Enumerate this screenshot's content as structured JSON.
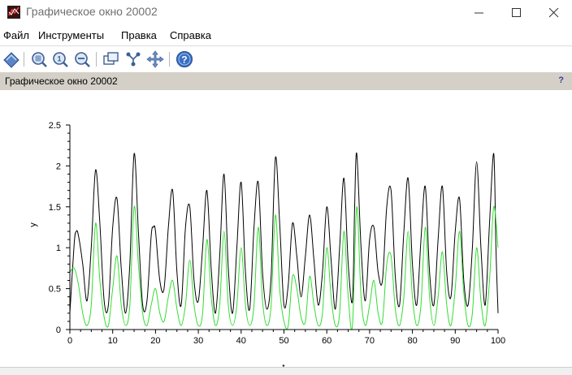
{
  "window": {
    "title": "Графическое окно 20002",
    "icon": "scilab-graphics-icon",
    "controls": [
      "minimize-icon",
      "maximize-icon",
      "close-icon"
    ]
  },
  "menubar": {
    "items": [
      "Файл",
      "Инструменты",
      "Правка",
      "Справка"
    ]
  },
  "toolbar": {
    "buttons": [
      "datatip-icon",
      "zoom-in-icon",
      "zoom-original-icon",
      "zoom-out-icon",
      "rotate-icon",
      "edit-axes-icon",
      "pan-icon",
      "help-icon"
    ]
  },
  "infobar": {
    "label": "Графическое окно 20002",
    "help_mark": "?"
  },
  "chart_data": {
    "type": "line",
    "xlabel": "t",
    "ylabel": "y",
    "xlim": [
      0,
      100
    ],
    "ylim": [
      0,
      2.5
    ],
    "xticks": [
      "0",
      "10",
      "20",
      "30",
      "40",
      "50",
      "60",
      "70",
      "80",
      "90",
      "100"
    ],
    "yticks": [
      "0",
      "0.5",
      "1",
      "1.5",
      "2",
      "2.5"
    ],
    "grid": false,
    "legend": "none",
    "series": [
      {
        "color": "#000000",
        "points": [
          [
            0,
            0.2
          ],
          [
            1,
            1.05
          ],
          [
            1.5,
            1.2
          ],
          [
            2,
            1.15
          ],
          [
            3,
            0.8
          ],
          [
            4,
            0.35
          ],
          [
            5,
            1.0
          ],
          [
            6,
            1.95
          ],
          [
            7,
            1.3
          ],
          [
            8,
            0.35
          ],
          [
            9,
            0.3
          ],
          [
            10,
            1.25
          ],
          [
            11,
            1.6
          ],
          [
            12,
            0.75
          ],
          [
            13,
            0.2
          ],
          [
            14,
            0.8
          ],
          [
            15,
            2.15
          ],
          [
            16,
            1.2
          ],
          [
            17,
            0.3
          ],
          [
            18,
            0.35
          ],
          [
            19,
            1.15
          ],
          [
            19.5,
            1.25
          ],
          [
            20,
            1.2
          ],
          [
            21,
            0.6
          ],
          [
            22,
            0.5
          ],
          [
            23,
            1.25
          ],
          [
            24,
            1.7
          ],
          [
            25,
            0.7
          ],
          [
            26,
            0.3
          ],
          [
            27,
            1.25
          ],
          [
            28,
            1.5
          ],
          [
            29,
            0.6
          ],
          [
            30,
            0.35
          ],
          [
            31,
            1.0
          ],
          [
            32,
            1.7
          ],
          [
            33,
            0.75
          ],
          [
            34,
            0.2
          ],
          [
            35,
            0.9
          ],
          [
            36,
            1.9
          ],
          [
            37,
            0.75
          ],
          [
            38,
            0.2
          ],
          [
            39,
            1.0
          ],
          [
            40,
            1.8
          ],
          [
            41,
            0.7
          ],
          [
            42,
            0.25
          ],
          [
            43,
            1.25
          ],
          [
            44,
            1.8
          ],
          [
            45,
            0.7
          ],
          [
            46,
            0.25
          ],
          [
            47,
            0.65
          ],
          [
            48,
            2.1
          ],
          [
            49,
            1.3
          ],
          [
            50,
            0.3
          ],
          [
            51,
            0.55
          ],
          [
            52,
            1.3
          ],
          [
            53,
            0.9
          ],
          [
            54,
            0.4
          ],
          [
            55,
            0.9
          ],
          [
            56,
            1.4
          ],
          [
            57,
            0.85
          ],
          [
            58,
            0.3
          ],
          [
            59,
            0.7
          ],
          [
            60,
            1.5
          ],
          [
            61,
            0.85
          ],
          [
            62,
            0.25
          ],
          [
            63,
            1.0
          ],
          [
            64,
            1.85
          ],
          [
            65,
            0.8
          ],
          [
            66,
            0.35
          ],
          [
            66.5,
            1.5
          ],
          [
            67,
            2.15
          ],
          [
            68,
            1.0
          ],
          [
            69,
            0.35
          ],
          [
            70,
            1.1
          ],
          [
            71,
            1.25
          ],
          [
            72,
            0.7
          ],
          [
            73,
            0.6
          ],
          [
            74,
            1.5
          ],
          [
            75,
            1.7
          ],
          [
            76,
            0.65
          ],
          [
            77,
            0.3
          ],
          [
            78,
            1.2
          ],
          [
            79,
            1.85
          ],
          [
            80,
            0.8
          ],
          [
            81,
            0.3
          ],
          [
            82,
            1.1
          ],
          [
            83,
            1.75
          ],
          [
            84,
            0.7
          ],
          [
            85,
            0.3
          ],
          [
            86,
            1.1
          ],
          [
            87,
            1.75
          ],
          [
            88,
            0.7
          ],
          [
            89,
            0.4
          ],
          [
            90,
            1.2
          ],
          [
            91,
            1.6
          ],
          [
            92,
            0.6
          ],
          [
            93,
            0.3
          ],
          [
            94,
            1.0
          ],
          [
            95,
            2.05
          ],
          [
            96,
            1.0
          ],
          [
            97,
            0.3
          ],
          [
            98,
            1.3
          ],
          [
            99,
            2.15
          ],
          [
            99.5,
            1.0
          ],
          [
            100,
            0.2
          ]
        ]
      },
      {
        "color": "#33dd33",
        "points": [
          [
            0,
            0.7
          ],
          [
            1,
            0.75
          ],
          [
            2,
            0.55
          ],
          [
            3,
            0.2
          ],
          [
            4,
            0.05
          ],
          [
            5,
            0.3
          ],
          [
            6,
            1.3
          ],
          [
            7,
            0.6
          ],
          [
            8,
            0.15
          ],
          [
            9,
            0.05
          ],
          [
            10,
            0.5
          ],
          [
            11,
            0.9
          ],
          [
            12,
            0.3
          ],
          [
            13,
            0.05
          ],
          [
            14,
            0.3
          ],
          [
            15,
            1.5
          ],
          [
            16,
            0.8
          ],
          [
            17,
            0.2
          ],
          [
            18,
            0.05
          ],
          [
            19,
            0.3
          ],
          [
            20,
            0.5
          ],
          [
            21,
            0.2
          ],
          [
            22,
            0.1
          ],
          [
            23,
            0.4
          ],
          [
            24,
            0.6
          ],
          [
            25,
            0.25
          ],
          [
            26,
            0.05
          ],
          [
            27,
            0.3
          ],
          [
            28,
            0.85
          ],
          [
            29,
            0.3
          ],
          [
            30,
            0.05
          ],
          [
            31,
            0.2
          ],
          [
            32,
            1.1
          ],
          [
            33,
            0.4
          ],
          [
            34,
            0.05
          ],
          [
            35,
            0.3
          ],
          [
            36,
            1.2
          ],
          [
            37,
            0.3
          ],
          [
            38,
            0.05
          ],
          [
            39,
            0.3
          ],
          [
            40,
            1.0
          ],
          [
            41,
            0.3
          ],
          [
            42,
            0.05
          ],
          [
            43,
            0.3
          ],
          [
            44,
            1.25
          ],
          [
            45,
            0.35
          ],
          [
            46,
            0.05
          ],
          [
            47,
            0.3
          ],
          [
            48,
            1.4
          ],
          [
            49,
            0.5
          ],
          [
            50,
            0.1
          ],
          [
            51,
            0.05
          ],
          [
            52,
            0.65
          ],
          [
            53,
            0.5
          ],
          [
            54,
            0.15
          ],
          [
            55,
            0.1
          ],
          [
            56,
            0.65
          ],
          [
            57,
            0.3
          ],
          [
            58,
            0.05
          ],
          [
            59,
            0.2
          ],
          [
            60,
            1.0
          ],
          [
            61,
            0.4
          ],
          [
            62,
            0.05
          ],
          [
            63,
            0.2
          ],
          [
            64,
            1.2
          ],
          [
            65,
            0.4
          ],
          [
            66,
            0.05
          ],
          [
            67,
            1.5
          ],
          [
            68,
            0.4
          ],
          [
            69,
            0.05
          ],
          [
            70,
            0.3
          ],
          [
            71,
            0.6
          ],
          [
            72,
            0.2
          ],
          [
            73,
            0.1
          ],
          [
            74,
            0.8
          ],
          [
            75,
            0.9
          ],
          [
            76,
            0.25
          ],
          [
            77,
            0.05
          ],
          [
            78,
            0.4
          ],
          [
            79,
            1.2
          ],
          [
            80,
            0.4
          ],
          [
            81,
            0.05
          ],
          [
            82,
            0.3
          ],
          [
            83,
            1.25
          ],
          [
            84,
            0.4
          ],
          [
            85,
            0.05
          ],
          [
            86,
            0.4
          ],
          [
            87,
            0.95
          ],
          [
            88,
            0.3
          ],
          [
            89,
            0.05
          ],
          [
            90,
            0.5
          ],
          [
            91,
            1.2
          ],
          [
            92,
            0.45
          ],
          [
            93,
            0.05
          ],
          [
            94,
            0.2
          ],
          [
            95,
            1.0
          ],
          [
            96,
            0.35
          ],
          [
            97,
            0.05
          ],
          [
            98,
            0.6
          ],
          [
            99,
            1.5
          ],
          [
            100,
            1.0
          ]
        ]
      }
    ]
  }
}
